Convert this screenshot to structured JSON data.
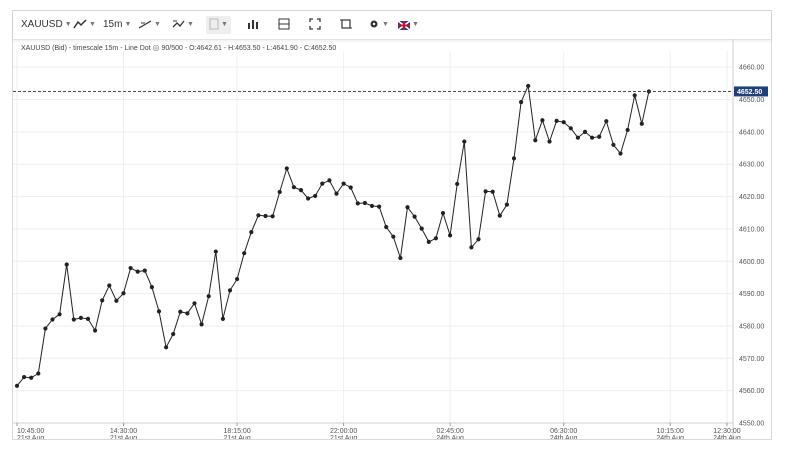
{
  "toolbar": {
    "symbol": "XAUUSD",
    "timeframe": "15m",
    "icons": [
      "line-style-icon",
      "trend-line-icon",
      "compare-icon",
      "template-icon",
      "bar-chart-icon",
      "horizontal-line-icon",
      "fullscreen-icon",
      "screenshot-icon",
      "settings-icon",
      "uk-flag-icon"
    ]
  },
  "info_line": {
    "instrument": "XAUUSD (Bid)",
    "timescale": "timescale 15m",
    "style": "Line Dot",
    "count": "90/500",
    "open": "O:4642.61",
    "high": "H:4653.50",
    "low": "L:4641.90",
    "close": "C:4652.50"
  },
  "current_price_label": "4652.50",
  "colors": {
    "line": "#222222",
    "grid": "#eeeeee",
    "current_label_bg": "#1f3f7a"
  },
  "chart_data": {
    "type": "line",
    "title": "",
    "xlabel": "",
    "ylabel": "",
    "ylim": [
      4550,
      4665
    ],
    "yticks": [
      "4550.00",
      "4560.00",
      "4570.00",
      "4580.00",
      "4590.00",
      "4600.00",
      "4610.00",
      "4620.00",
      "4630.00",
      "4640.00",
      "4650.00",
      "4660.00"
    ],
    "xticks": [
      {
        "time": "10:45:00",
        "date": "21st Aug"
      },
      {
        "time": "14:30:00",
        "date": "21st Aug"
      },
      {
        "time": "18:15:00",
        "date": "21st Aug"
      },
      {
        "time": "22:00:00",
        "date": "21st Aug"
      },
      {
        "time": "02:45:00",
        "date": "24th Aug"
      },
      {
        "time": "06:30:00",
        "date": "24th Aug"
      },
      {
        "time": "10:15:00",
        "date": "24th Aug"
      },
      {
        "time": "12:30:00",
        "date": "24th Aug"
      }
    ],
    "last_value": 4652.5,
    "grid": true,
    "series": [
      {
        "values": [
          4561.5,
          4564.2,
          4564.0,
          4565.3,
          4579.2,
          4582.0,
          4583.6,
          4599.0,
          4582.0,
          4582.5,
          4582.2,
          4578.6,
          4587.9,
          4592.5,
          4587.8,
          4590.1,
          4597.9,
          4596.8,
          4597.1,
          4592.0,
          4584.5,
          4573.4,
          4577.5,
          4584.4,
          4583.9,
          4587.0,
          4580.5,
          4589.2,
          4603.0,
          4582.2,
          4591.0,
          4594.5,
          4602.5,
          4609.0,
          4614.2,
          4614.0,
          4613.9,
          4621.4,
          4628.7,
          4622.9,
          4622.0,
          4619.4,
          4620.2,
          4624.0,
          4625.0,
          4620.9,
          4624.0,
          4622.8,
          4617.9,
          4618.0,
          4617.1,
          4616.9,
          4610.6,
          4607.6,
          4601.0,
          4616.7,
          4613.8,
          4610.1,
          4606.0,
          4607.1,
          4614.9,
          4608.0,
          4623.9,
          4637.0,
          4604.3,
          4606.8,
          4621.6,
          4621.5,
          4614.1,
          4617.5,
          4631.8,
          4649.2,
          4654.2,
          4637.4,
          4643.6,
          4637.0,
          4643.4,
          4643.0,
          4641.1,
          4638.2,
          4640.0,
          4638.2,
          4638.5,
          4643.3,
          4636.0,
          4633.3,
          4640.6,
          4651.3,
          4642.5,
          4652.5
        ]
      }
    ]
  }
}
